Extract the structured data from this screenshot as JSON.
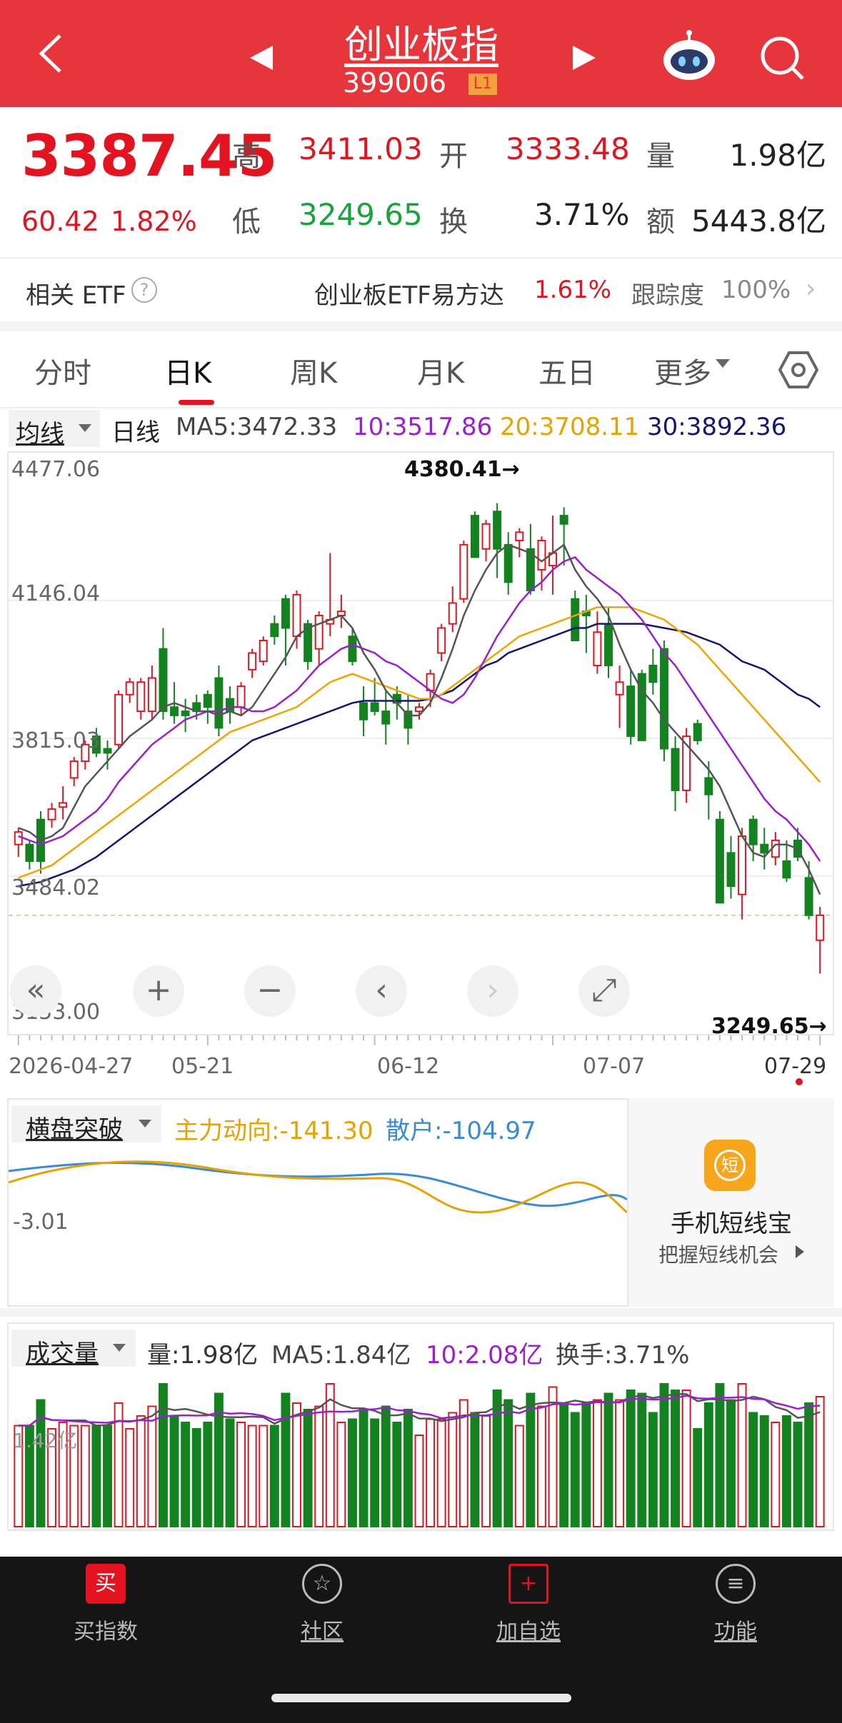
{
  "header": {
    "title": "创业板指",
    "code": "399006",
    "level_badge": "L1"
  },
  "quote": {
    "price": "3387.45",
    "change": "60.42",
    "change_pct": "1.82%",
    "high_label": "高",
    "high": "3411.03",
    "open_label": "开",
    "open": "3333.48",
    "volume_label": "量",
    "volume": "1.98亿",
    "low_label": "低",
    "low": "3249.65",
    "turnover_label": "换",
    "turnover": "3.71%",
    "amount_label": "额",
    "amount": "5443.8亿"
  },
  "etf": {
    "label": "相关 ETF",
    "name": "创业板ETF易方达",
    "pct": "1.61%",
    "track_label": "跟踪度",
    "track_value": "100%"
  },
  "tabs": [
    "分时",
    "日K",
    "周K",
    "月K",
    "五日",
    "更多"
  ],
  "active_tab": 1,
  "ma_bar": {
    "selector": "均线",
    "period": "日线",
    "ma5": "MA5:3472.33",
    "ma10": "10:3517.86",
    "ma20": "20:3708.11",
    "ma30": "30:3892.36"
  },
  "colors": {
    "up": "#e3141f",
    "down": "#13831f",
    "ma5": "#555555",
    "ma10": "#9b1fd0",
    "ma20": "#f0a400",
    "ma30": "#16166e",
    "header": "#e8343b"
  },
  "price_axis": [
    "4477.06",
    "4146.04",
    "3815.03",
    "3484.02",
    "3153.00"
  ],
  "max_marker": "4380.41→",
  "min_marker": "3249.65→",
  "date_axis": [
    "2026-04-27",
    "05-21",
    "06-12",
    "07-07",
    "07-29"
  ],
  "controls": [
    "«",
    "+",
    "−",
    "‹",
    "›",
    "⤢"
  ],
  "indicator": {
    "selector": "横盘突破",
    "main": "主力动向:-141.30",
    "retail": "散户:-104.97",
    "axis": "-3.01"
  },
  "promo": {
    "icon_text": "短",
    "title": "手机短线宝",
    "subtitle": "把握短线机会"
  },
  "volume_bar": {
    "selector": "成交量",
    "vol": "量:1.98亿",
    "ma5": "MA5:1.84亿",
    "ma10": "10:2.08亿",
    "turnover": "换手:3.71%",
    "axis": "1.42亿"
  },
  "tabbar": [
    {
      "label": "买指数",
      "icon": "买"
    },
    {
      "label": "社区",
      "icon": "☆"
    },
    {
      "label": "加自选",
      "icon": "+"
    },
    {
      "label": "功能",
      "icon": "≡"
    }
  ],
  "chart_data": {
    "type": "candlestick",
    "ylim": [
      3153.0,
      4477.06
    ],
    "x_ticks": [
      "2026-04-27",
      "05-21",
      "06-12",
      "07-07",
      "07-29"
    ],
    "candles": [
      [
        3560,
        3600,
        3530,
        3590
      ],
      [
        3560,
        3570,
        3500,
        3520
      ],
      [
        3620,
        3640,
        3490,
        3520
      ],
      [
        3620,
        3660,
        3600,
        3645
      ],
      [
        3650,
        3700,
        3620,
        3660
      ],
      [
        3720,
        3770,
        3700,
        3760
      ],
      [
        3760,
        3810,
        3740,
        3800
      ],
      [
        3820,
        3840,
        3770,
        3780
      ],
      [
        3790,
        3810,
        3740,
        3780
      ],
      [
        3800,
        3930,
        3790,
        3920
      ],
      [
        3920,
        3960,
        3900,
        3950
      ],
      [
        3880,
        3960,
        3860,
        3950
      ],
      [
        3880,
        3990,
        3860,
        3960
      ],
      [
        4030,
        4080,
        3860,
        3880
      ],
      [
        3890,
        3950,
        3850,
        3870
      ],
      [
        3880,
        3910,
        3830,
        3870
      ],
      [
        3900,
        3920,
        3860,
        3880
      ],
      [
        3920,
        3930,
        3850,
        3890
      ],
      [
        3960,
        3990,
        3820,
        3840
      ],
      [
        3910,
        3940,
        3850,
        3880
      ],
      [
        3890,
        3950,
        3870,
        3940
      ],
      [
        3980,
        4030,
        3960,
        4020
      ],
      [
        4000,
        4060,
        3990,
        4050
      ],
      [
        4090,
        4110,
        4040,
        4060
      ],
      [
        4150,
        4160,
        3990,
        4080
      ],
      [
        4060,
        4170,
        4030,
        4160
      ],
      [
        4090,
        4100,
        3980,
        4000
      ],
      [
        4030,
        4120,
        3990,
        4110
      ],
      [
        4090,
        4260,
        4060,
        4100
      ],
      [
        4110,
        4160,
        4080,
        4120
      ],
      [
        4060,
        4080,
        3990,
        4000
      ],
      [
        3900,
        3940,
        3820,
        3860
      ],
      [
        3900,
        3960,
        3870,
        3880
      ],
      [
        3880,
        3930,
        3800,
        3850
      ],
      [
        3920,
        3940,
        3860,
        3900
      ],
      [
        3880,
        3920,
        3800,
        3840
      ],
      [
        3880,
        3900,
        3860,
        3890
      ],
      [
        3930,
        3980,
        3890,
        3970
      ],
      [
        4020,
        4090,
        4000,
        4080
      ],
      [
        4090,
        4180,
        4070,
        4140
      ],
      [
        4150,
        4290,
        4140,
        4280
      ],
      [
        4350,
        4360,
        4250,
        4250
      ],
      [
        4270,
        4340,
        4240,
        4330
      ],
      [
        4360,
        4380,
        4200,
        4270
      ],
      [
        4280,
        4310,
        4160,
        4190
      ],
      [
        4290,
        4320,
        4250,
        4310
      ],
      [
        4270,
        4330,
        4160,
        4170
      ],
      [
        4220,
        4300,
        4170,
        4290
      ],
      [
        4230,
        4350,
        4160,
        4260
      ],
      [
        4350,
        4370,
        4230,
        4330
      ],
      [
        4150,
        4170,
        4060,
        4050
      ],
      [
        4120,
        4160,
        4020,
        4110
      ],
      [
        3990,
        4120,
        3970,
        4070
      ],
      [
        4090,
        4130,
        3960,
        3990
      ],
      [
        3920,
        3990,
        3840,
        3950
      ],
      [
        3940,
        3980,
        3800,
        3820
      ],
      [
        3970,
        3980,
        3810,
        3810
      ],
      [
        3990,
        4030,
        3920,
        3950
      ],
      [
        4030,
        4050,
        3760,
        3790
      ],
      [
        3790,
        3820,
        3640,
        3690
      ],
      [
        3690,
        3840,
        3660,
        3820
      ],
      [
        3850,
        3860,
        3800,
        3810
      ],
      [
        3720,
        3760,
        3620,
        3680
      ],
      [
        3620,
        3640,
        3420,
        3420
      ],
      [
        3540,
        3580,
        3430,
        3460
      ],
      [
        3440,
        3600,
        3380,
        3580
      ],
      [
        3620,
        3630,
        3520,
        3560
      ],
      [
        3560,
        3600,
        3500,
        3540
      ],
      [
        3530,
        3590,
        3510,
        3570
      ],
      [
        3520,
        3570,
        3470,
        3480
      ],
      [
        3570,
        3600,
        3520,
        3530
      ],
      [
        3480,
        3520,
        3380,
        3390
      ],
      [
        3330,
        3410,
        3250,
        3390
      ]
    ],
    "ma5": [
      3600,
      3590,
      3570,
      3580,
      3600,
      3650,
      3700,
      3730,
      3760,
      3790,
      3820,
      3840,
      3860,
      3890,
      3900,
      3890,
      3880,
      3880,
      3870,
      3880,
      3870,
      3890,
      3930,
      3970,
      4010,
      4060,
      4080,
      4090,
      4100,
      4110,
      4080,
      4020,
      3980,
      3930,
      3900,
      3870,
      3870,
      3900,
      3960,
      4030,
      4110,
      4170,
      4220,
      4260,
      4280,
      4270,
      4260,
      4240,
      4260,
      4280,
      4220,
      4180,
      4150,
      4110,
      4040,
      3980,
      3930,
      3900,
      3860,
      3830,
      3800,
      3770,
      3740,
      3700,
      3640,
      3580,
      3540,
      3530,
      3560,
      3560,
      3550,
      3500,
      3440
    ],
    "ma10": [
      3580,
      3570,
      3560,
      3570,
      3580,
      3600,
      3620,
      3640,
      3670,
      3710,
      3740,
      3770,
      3800,
      3820,
      3840,
      3860,
      3870,
      3880,
      3880,
      3890,
      3890,
      3880,
      3880,
      3890,
      3910,
      3930,
      3960,
      3990,
      4010,
      4030,
      4040,
      4030,
      4020,
      4000,
      3990,
      3970,
      3950,
      3930,
      3910,
      3900,
      3920,
      3960,
      4010,
      4060,
      4100,
      4140,
      4170,
      4190,
      4220,
      4240,
      4250,
      4220,
      4200,
      4180,
      4160,
      4130,
      4100,
      4060,
      4020,
      3990,
      3950,
      3910,
      3870,
      3830,
      3790,
      3750,
      3710,
      3670,
      3640,
      3620,
      3590,
      3560,
      3520
    ],
    "ma20": [
      3480,
      3490,
      3500,
      3510,
      3530,
      3550,
      3570,
      3590,
      3610,
      3630,
      3650,
      3670,
      3690,
      3710,
      3730,
      3750,
      3770,
      3790,
      3810,
      3830,
      3840,
      3850,
      3860,
      3870,
      3880,
      3890,
      3910,
      3930,
      3950,
      3960,
      3970,
      3960,
      3950,
      3940,
      3930,
      3920,
      3910,
      3910,
      3920,
      3940,
      3960,
      3980,
      4000,
      4020,
      4040,
      4060,
      4070,
      4080,
      4090,
      4100,
      4110,
      4120,
      4130,
      4130,
      4130,
      4130,
      4120,
      4110,
      4100,
      4080,
      4060,
      4040,
      4010,
      3980,
      3950,
      3920,
      3890,
      3860,
      3830,
      3800,
      3770,
      3740,
      3710
    ],
    "ma30": [
      3460,
      3465,
      3470,
      3480,
      3490,
      3500,
      3515,
      3530,
      3550,
      3570,
      3590,
      3610,
      3630,
      3650,
      3670,
      3690,
      3710,
      3730,
      3750,
      3770,
      3790,
      3810,
      3820,
      3830,
      3840,
      3850,
      3860,
      3870,
      3880,
      3890,
      3900,
      3905,
      3905,
      3905,
      3905,
      3905,
      3905,
      3910,
      3920,
      3930,
      3950,
      3970,
      3990,
      4000,
      4020,
      4030,
      4040,
      4050,
      4060,
      4070,
      4080,
      4080,
      4090,
      4090,
      4090,
      4090,
      4090,
      4085,
      4080,
      4075,
      4070,
      4060,
      4050,
      4040,
      4020,
      4000,
      3990,
      3980,
      3960,
      3940,
      3920,
      3910,
      3890
    ],
    "volume_series": "bars mirror candle direction"
  }
}
